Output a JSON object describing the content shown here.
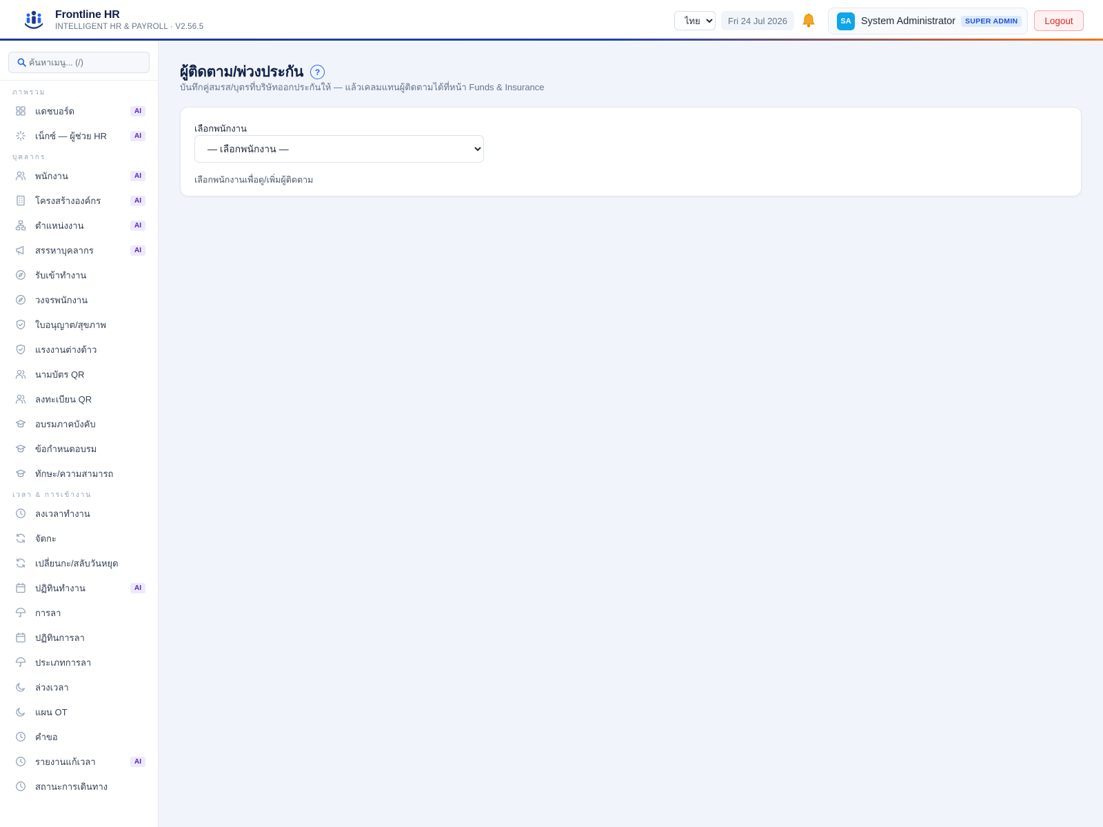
{
  "header": {
    "brand_name": "Frontline HR",
    "brand_sub": "INTELLIGENT HR & PAYROLL · V2.56.5",
    "language": "ไทย",
    "date": "Fri 24 Jul 2026",
    "user": {
      "initials": "SA",
      "name": "System Administrator",
      "role": "SUPER ADMIN"
    },
    "logout_label": "Logout",
    "colors": {
      "brand": "#0f1f47",
      "accent": "#2563eb",
      "avatar": "#0ea5e9",
      "logout": "#dc2626"
    }
  },
  "sidebar": {
    "search_placeholder": "ค้นหาเมนู... (/)",
    "groups": [
      {
        "label": "ภาพรวม",
        "items": [
          {
            "label": "แดชบอร์ด",
            "icon": "grid-icon",
            "ai": "AI"
          },
          {
            "label": "เน็กซ์ — ผู้ช่วย HR",
            "icon": "spinner-icon",
            "ai": "AI"
          }
        ]
      },
      {
        "label": "บุคลากร",
        "items": [
          {
            "label": "พนักงาน",
            "icon": "users-icon",
            "ai": "AI"
          },
          {
            "label": "โครงสร้างองค์กร",
            "icon": "building-icon",
            "ai": "AI"
          },
          {
            "label": "ตำแหน่งงาน",
            "icon": "org-chart-icon",
            "ai": "AI"
          },
          {
            "label": "สรรหาบุคลากร",
            "icon": "megaphone-icon",
            "ai": "AI"
          },
          {
            "label": "รับเข้าทำงาน",
            "icon": "compass-icon"
          },
          {
            "label": "วงจรพนักงาน",
            "icon": "compass-icon"
          },
          {
            "label": "ใบอนุญาต/สุขภาพ",
            "icon": "shield-icon"
          },
          {
            "label": "แรงงานต่างด้าว",
            "icon": "shield-icon"
          },
          {
            "label": "นามบัตร QR",
            "icon": "users-icon"
          },
          {
            "label": "ลงทะเบียน QR",
            "icon": "users-icon"
          },
          {
            "label": "อบรมภาคบังคับ",
            "icon": "graduation-cap-icon"
          },
          {
            "label": "ข้อกำหนดอบรม",
            "icon": "graduation-cap-icon"
          },
          {
            "label": "ทักษะ/ความสามารถ",
            "icon": "graduation-cap-icon"
          }
        ]
      },
      {
        "label": "เวลา & การเข้างาน",
        "items": [
          {
            "label": "ลงเวลาทำงาน",
            "icon": "clock-icon"
          },
          {
            "label": "จัดกะ",
            "icon": "refresh-icon"
          },
          {
            "label": "เปลี่ยนกะ/สลับวันหยุด",
            "icon": "refresh-icon"
          },
          {
            "label": "ปฏิทินทำงาน",
            "icon": "calendar-icon",
            "ai": "AI"
          },
          {
            "label": "การลา",
            "icon": "umbrella-icon"
          },
          {
            "label": "ปฏิทินการลา",
            "icon": "calendar-icon"
          },
          {
            "label": "ประเภทการลา",
            "icon": "umbrella-icon"
          },
          {
            "label": "ล่วงเวลา",
            "icon": "moon-icon"
          },
          {
            "label": "แผน OT",
            "icon": "moon-icon"
          },
          {
            "label": "คำขอ",
            "icon": "clock-icon"
          },
          {
            "label": "รายงานแก้เวลา",
            "icon": "clock-icon",
            "ai": "AI"
          },
          {
            "label": "สถานะการเดินทาง",
            "icon": "clock-icon"
          }
        ]
      }
    ]
  },
  "main": {
    "title": "ผู้ติดตาม/พ่วงประกัน",
    "help": "?",
    "subtitle": "บันทึกคู่สมรส/บุตรที่บริษัทออกประกันให้ — แล้วเคลมแทนผู้ติดตามได้ที่หน้า Funds & Insurance",
    "employee_label": "เลือกพนักงาน",
    "employee_select_value": "— เลือกพนักงาน —",
    "employee_hint": "เลือกพนักงานเพื่อดู/เพิ่มผู้ติดตาม"
  }
}
